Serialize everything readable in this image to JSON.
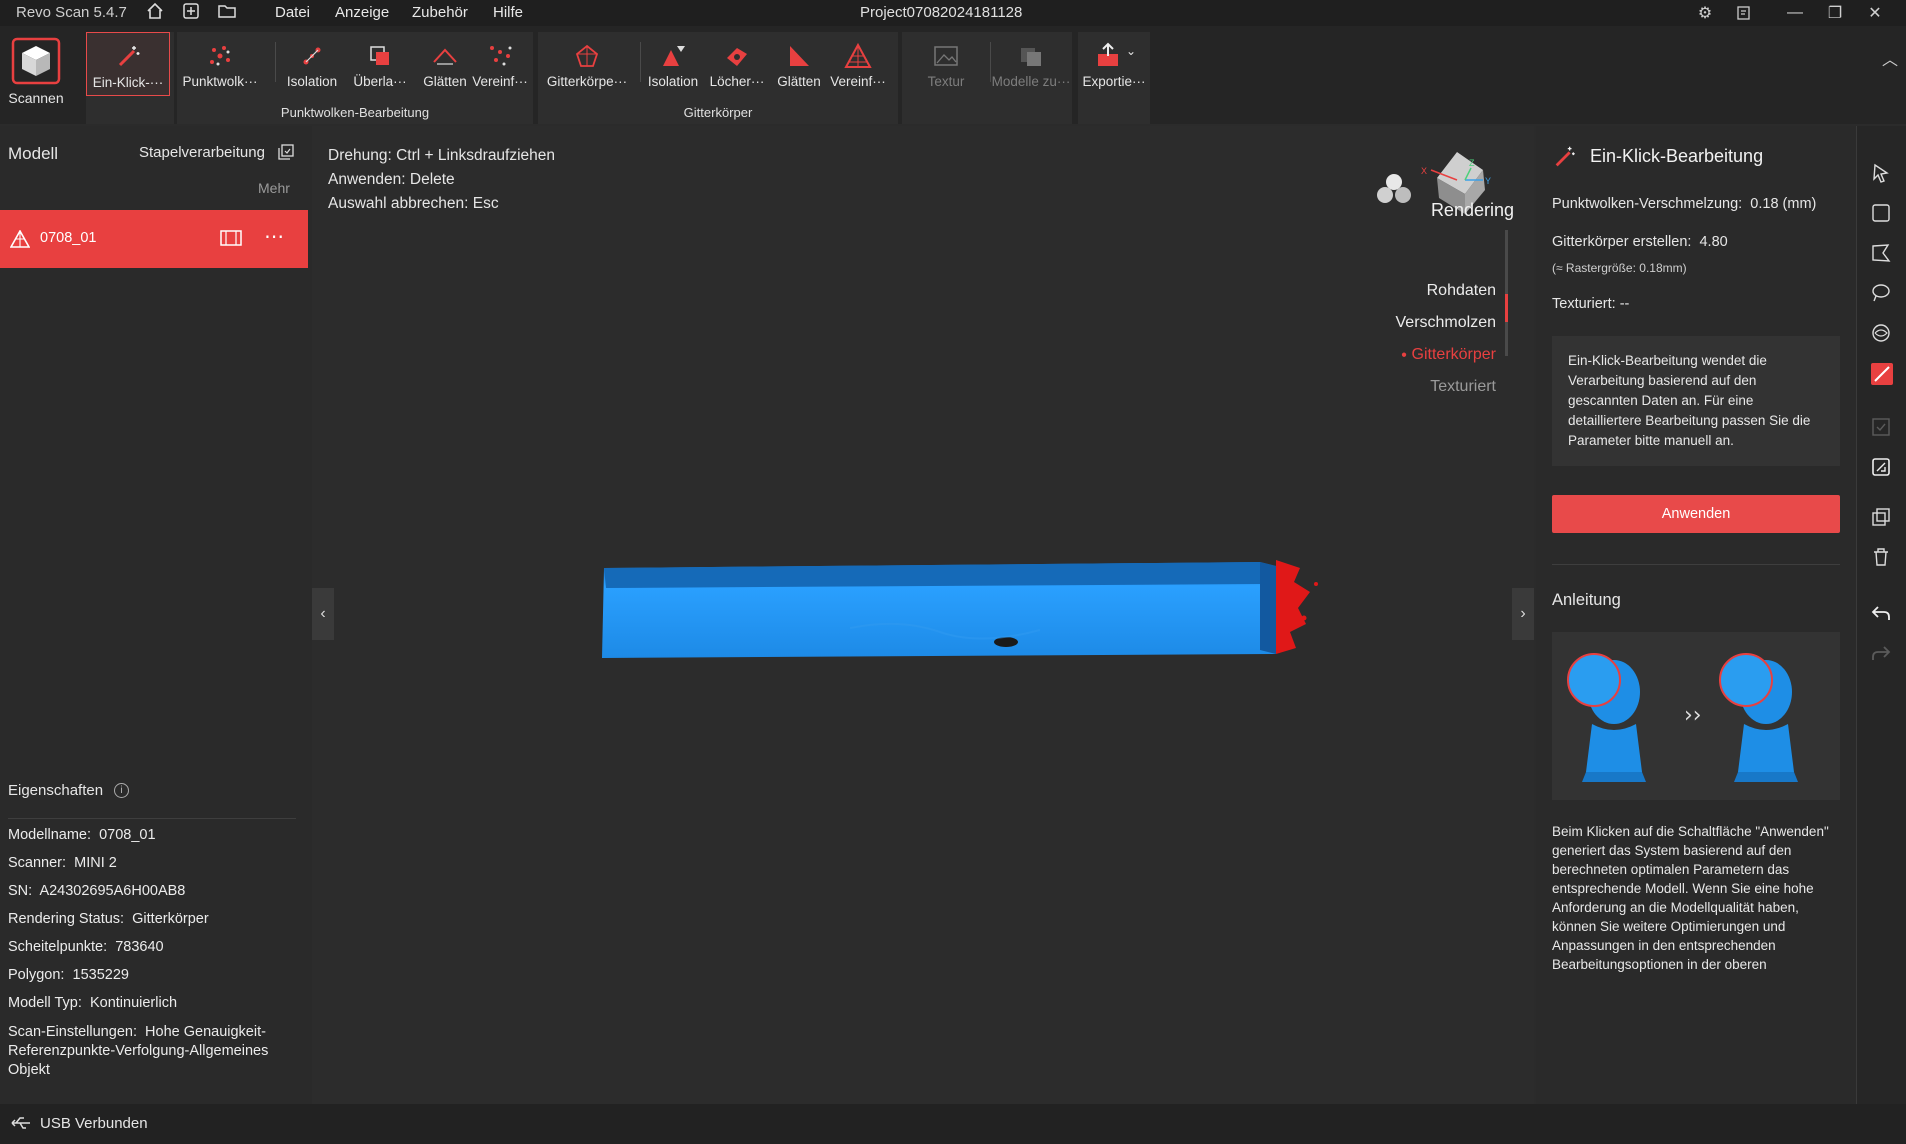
{
  "titlebar": {
    "app": "Revo Scan 5.4.7",
    "menu": [
      "Datei",
      "Anzeige",
      "Zubehör",
      "Hilfe"
    ],
    "project": "Project07082024181128"
  },
  "toolbar": {
    "scan": "Scannen",
    "one_click": "Ein-Klick-···",
    "pc_tools": [
      "Punktwolk···",
      "Isolation",
      "Überla···",
      "Glätten",
      "Vereinf···"
    ],
    "pc_group": "Punktwolken-Bearbeitung",
    "mesh_tools": [
      "Gitterkörpe···",
      "Isolation",
      "Löcher···",
      "Glätten",
      "Vereinf···"
    ],
    "mesh_group": "Gitterkörper",
    "texture": "Textur",
    "merge": "Modelle zu···",
    "export": "Exportie···"
  },
  "left": {
    "title": "Modell",
    "batch": "Stapelverarbeitung",
    "more": "Mehr",
    "model_name": "0708_01",
    "properties_title": "Eigenschaften",
    "props": [
      {
        "k": "Modellname:",
        "v": "0708_01"
      },
      {
        "k": "Scanner:",
        "v": "MINI 2"
      },
      {
        "k": "SN:",
        "v": "A24302695A6H00AB8"
      },
      {
        "k": "Rendering Status:",
        "v": "Gitterkörper"
      },
      {
        "k": "Scheitelpunkte:",
        "v": "783640"
      },
      {
        "k": "Polygon:",
        "v": "1535229"
      },
      {
        "k": "Modell Typ:",
        "v": "Kontinuierlich"
      },
      {
        "k": "Scan-Einstellungen:",
        "v": "Hohe Genauigkeit-Referenzpunkte-Verfolgung-Allgemeines Objekt"
      }
    ]
  },
  "viewport": {
    "hints": [
      {
        "k": "Drehung:",
        "v": "Ctrl + Linksdraufziehen"
      },
      {
        "k": "Anwenden:",
        "v": "Delete"
      },
      {
        "k": "Auswahl abbrechen:",
        "v": "Esc"
      }
    ],
    "rendering_title": "Rendering",
    "rendering_items": [
      "Rohdaten",
      "Verschmolzen",
      "Gitterkörper",
      "Texturiert"
    ],
    "rendering_active": 2
  },
  "right": {
    "title": "Ein-Klick-Bearbeitung",
    "fusion_label": "Punktwolken-Verschmelzung:",
    "fusion_value": "0.18 (mm)",
    "mesh_label": "Gitterkörper erstellen:",
    "mesh_value": "4.80",
    "grid_note": "(≈ Rastergröße: 0.18mm)",
    "textured_label": "Texturiert:",
    "textured_value": "--",
    "info": "Ein-Klick-Bearbeitung wendet die Verarbeitung basierend auf den gescannten Daten an. Für eine detailliertere Bearbeitung passen Sie die Parameter bitte manuell an.",
    "apply": "Anwenden",
    "guide_title": "Anleitung",
    "guide_text": "Beim Klicken auf die Schaltfläche \"Anwenden\" generiert das System basierend auf den berechneten optimalen Parametern das entsprechende Modell. Wenn Sie eine hohe Anforderung an die Modellqualität haben, können Sie weitere Optimierungen und Anpassungen in den entsprechenden Bearbeitungsoptionen in der oberen"
  },
  "status": {
    "text": "USB Verbunden"
  },
  "colors": {
    "accent": "#e84040",
    "mesh": "#1e90e8"
  }
}
